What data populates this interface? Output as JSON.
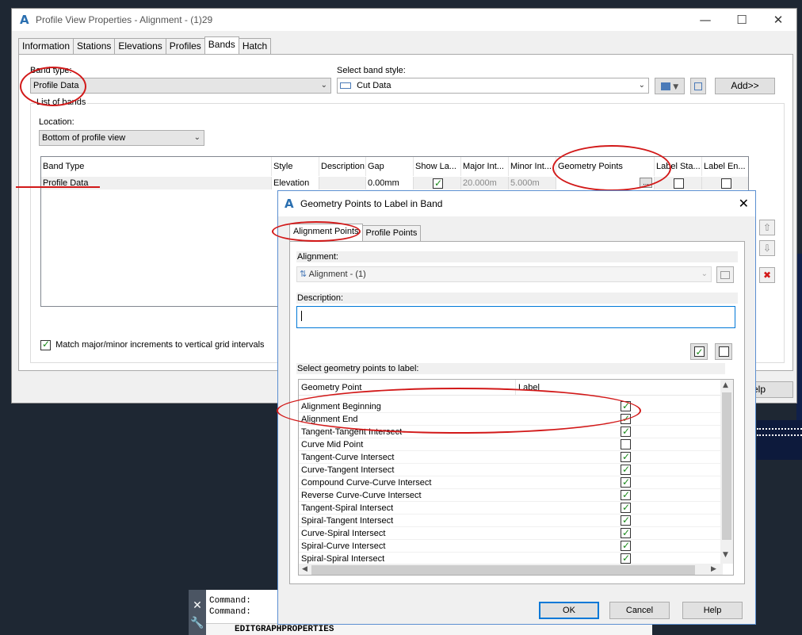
{
  "main_window": {
    "title": "Profile View Properties - Alignment - (1)29",
    "tabs": [
      "Information",
      "Stations",
      "Elevations",
      "Profiles",
      "Bands",
      "Hatch"
    ],
    "active_tab": "Bands",
    "band_type_label": "Band type:",
    "band_type_value": "Profile Data",
    "select_band_style_label": "Select band style:",
    "band_style_value": "Cut Data",
    "add_button": "Add>>",
    "list_of_bands_label": "List of bands",
    "location_label": "Location:",
    "location_value": "Bottom of profile view",
    "grid_headers": [
      "Band Type",
      "Style",
      "Description",
      "Gap",
      "Show La...",
      "Major Int...",
      "Minor Int...",
      "Geometry Points",
      "Label Sta...",
      "Label En..."
    ],
    "grid_row": {
      "band_type": "Profile Data",
      "style": "Elevation",
      "description": "",
      "gap": "0.00mm",
      "show_labels": true,
      "major_int": "20.000m",
      "minor_int": "5.000m",
      "geometry_points_button": "...",
      "label_start": false,
      "label_end": false
    },
    "match_checkbox_label": "Match major/minor increments to vertical grid intervals",
    "match_checked": true,
    "help_partial": "elp"
  },
  "dialog": {
    "title": "Geometry Points to Label in Band",
    "tabs": [
      "Alignment Points",
      "Profile Points"
    ],
    "active_tab": "Alignment Points",
    "alignment_label": "Alignment:",
    "alignment_value": "Alignment - (1)",
    "description_label": "Description:",
    "description_value": "",
    "select_label": "Select geometry points to label:",
    "col_geometry_point": "Geometry Point",
    "col_label": "Label",
    "points": [
      {
        "name": "Alignment Beginning",
        "checked": true
      },
      {
        "name": "Alignment End",
        "checked": true
      },
      {
        "name": "Tangent-Tangent Intersect",
        "checked": true
      },
      {
        "name": "Curve Mid Point",
        "checked": false
      },
      {
        "name": "Tangent-Curve Intersect",
        "checked": true
      },
      {
        "name": "Curve-Tangent Intersect",
        "checked": true
      },
      {
        "name": "Compound Curve-Curve Intersect",
        "checked": true
      },
      {
        "name": "Reverse Curve-Curve Intersect",
        "checked": true
      },
      {
        "name": "Tangent-Spiral Intersect",
        "checked": true
      },
      {
        "name": "Spiral-Tangent Intersect",
        "checked": true
      },
      {
        "name": "Curve-Spiral Intersect",
        "checked": true
      },
      {
        "name": "Spiral-Curve Intersect",
        "checked": true
      },
      {
        "name": "Spiral-Spiral Intersect",
        "checked": true
      }
    ],
    "ok_button": "OK",
    "cancel_button": "Cancel",
    "help_button": "Help"
  },
  "command_line": {
    "lines": [
      "Command:",
      "Command:"
    ],
    "input": "EDITGRAPHPROPERTIES"
  },
  "colors": {
    "annotation": "#d21919",
    "check": "#1a8a1a",
    "accent": "#0078d7"
  }
}
